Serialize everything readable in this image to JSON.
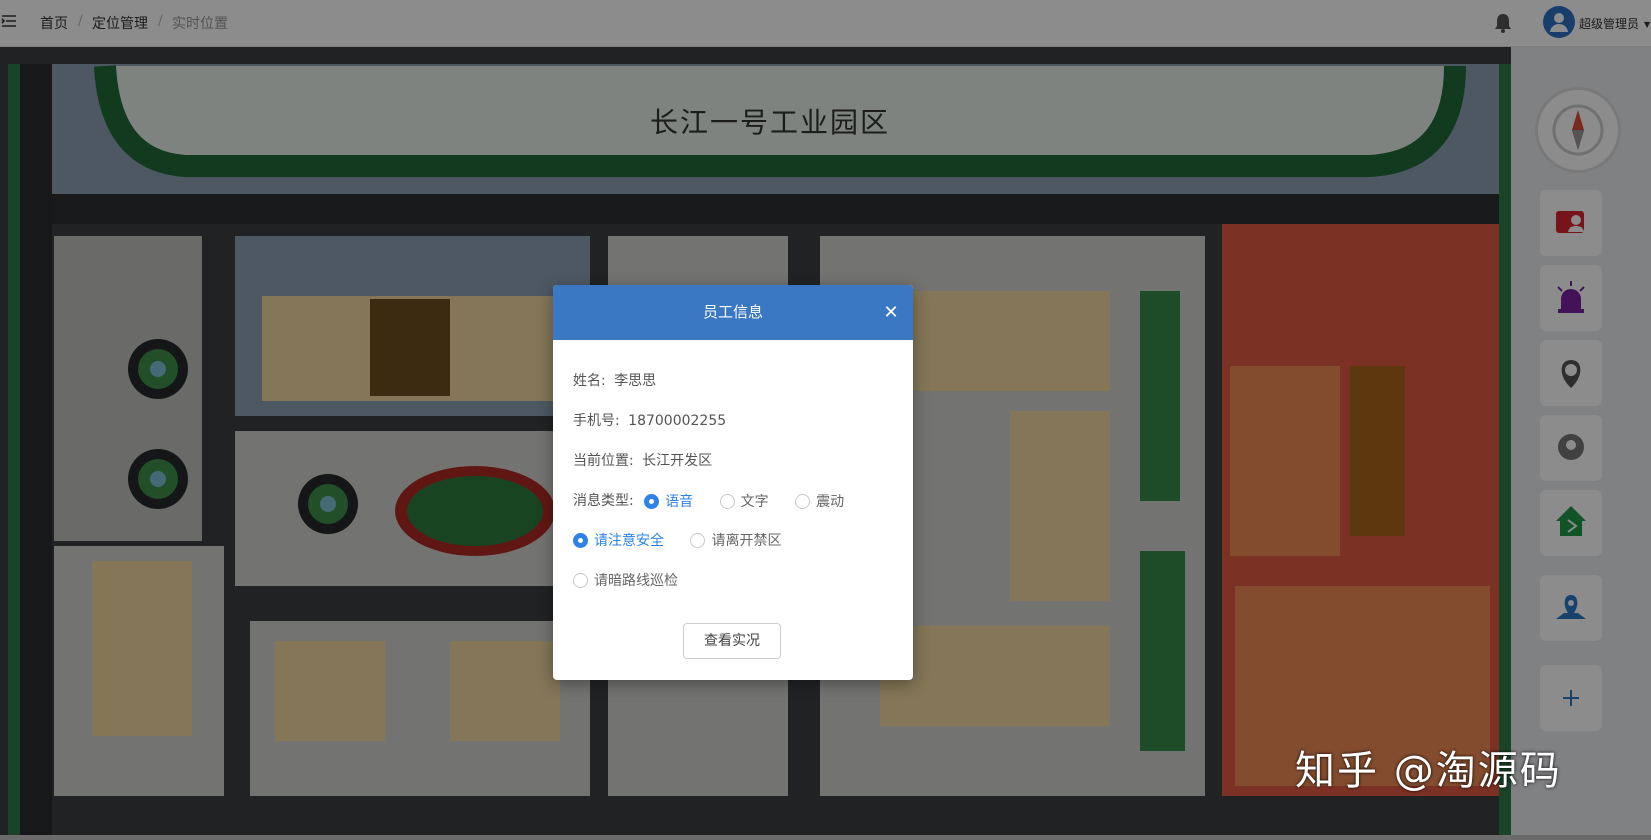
{
  "header": {
    "breadcrumb": [
      "首页",
      "定位管理",
      "实时位置"
    ],
    "user_name": "超级管理员"
  },
  "map": {
    "title": "长江一号工业园区"
  },
  "modal": {
    "title": "员工信息",
    "name_label": "姓名:",
    "name_value": "李思思",
    "phone_label": "手机号:",
    "phone_value": "18700002255",
    "location_label": "当前位置:",
    "location_value": "长江开发区",
    "msg_type_label": "消息类型:",
    "msg_types": [
      "语音",
      "文字",
      "震动"
    ],
    "selected_msg_type": "语音",
    "messages": [
      "请注意安全",
      "请离开禁区",
      "请暗路线巡检"
    ],
    "selected_message": "请注意安全",
    "button_label": "查看实况"
  },
  "watermark": "知乎 @淘源码",
  "colors": {
    "modal_header": "#3b78c3",
    "accent": "#2e82e8"
  },
  "icons": [
    "menu-icon",
    "bell-icon",
    "user-avatar-icon",
    "compass-icon",
    "alarm-person-icon",
    "siren-icon",
    "signal-tower-icon",
    "location-pin-icon",
    "fence-icon",
    "map-pin-icon",
    "plus-icon"
  ]
}
